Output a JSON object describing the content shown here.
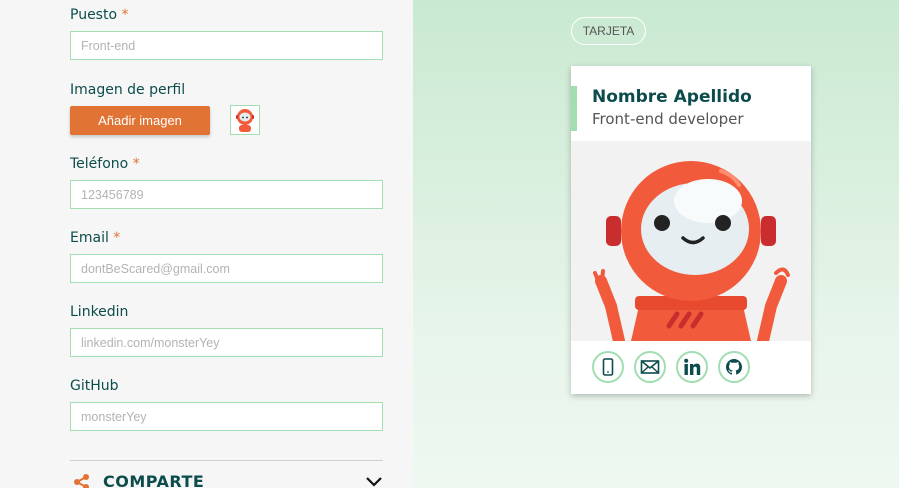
{
  "form": {
    "puesto": {
      "label": "Puesto",
      "required": "*",
      "placeholder": "Front-end"
    },
    "imagen": {
      "label": "Imagen de perfil",
      "button": "Añadir imagen"
    },
    "telefono": {
      "label": "Teléfono",
      "required": "*",
      "placeholder": "123456789"
    },
    "email": {
      "label": "Email",
      "required": "*",
      "placeholder": "dontBeScared@gmail.com"
    },
    "linkedin": {
      "label": "Linkedin",
      "placeholder": "linkedin.com/monsterYey"
    },
    "github": {
      "label": "GitHub",
      "placeholder": "monsterYey"
    }
  },
  "share": {
    "title": "COMPARTE",
    "icon": "share-icon",
    "toggle_icon": "chevron-down-icon"
  },
  "preview": {
    "tab": "TARJETA",
    "card": {
      "name": "Nombre Apellido",
      "job": "Front-end developer",
      "image": "robot-avatar",
      "social": [
        "phone-icon",
        "mail-icon",
        "linkedin-icon",
        "github-icon"
      ]
    }
  },
  "colors": {
    "accent": "#e17334",
    "text_dark": "#0c4c4c",
    "border_green": "#a2deb2"
  }
}
